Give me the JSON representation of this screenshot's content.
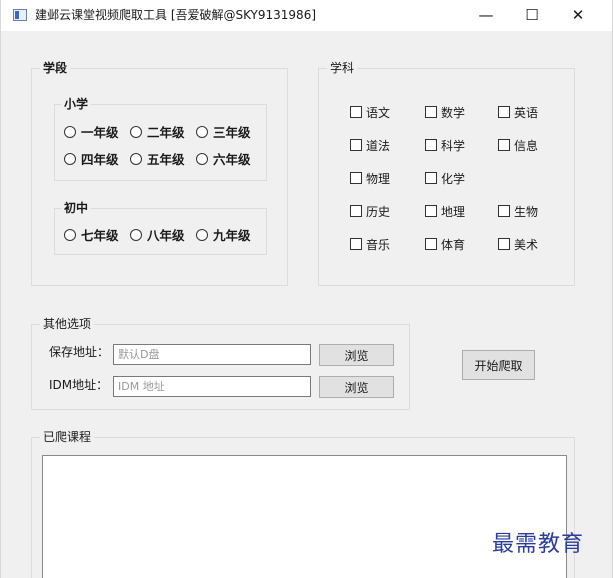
{
  "window": {
    "title": "建邺云课堂视频爬取工具 [吾爱破解@SKY9131986]",
    "minimize_glyph": "—",
    "maximize_glyph": "☐",
    "close_glyph": "✕"
  },
  "stage_group": {
    "title": "学段",
    "primary": {
      "title": "小学",
      "options": [
        "一年级",
        "二年级",
        "三年级",
        "四年级",
        "五年级",
        "六年级"
      ]
    },
    "junior": {
      "title": "初中",
      "options": [
        "七年级",
        "八年级",
        "九年级"
      ]
    }
  },
  "subject_group": {
    "title": "学科",
    "subjects": [
      "语文",
      "数学",
      "英语",
      "道法",
      "科学",
      "信息",
      "物理",
      "化学",
      "历史",
      "地理",
      "生物",
      "音乐",
      "体育",
      "美术"
    ]
  },
  "other_options": {
    "title": "其他选项",
    "save_label": "保存地址：",
    "save_placeholder": "默认D盘",
    "idm_label": "IDM地址：",
    "idm_placeholder": "IDM 地址",
    "browse_label": "浏览"
  },
  "start_button": "开始爬取",
  "crawled": {
    "title": "已爬课程"
  },
  "watermark": "最需教育"
}
